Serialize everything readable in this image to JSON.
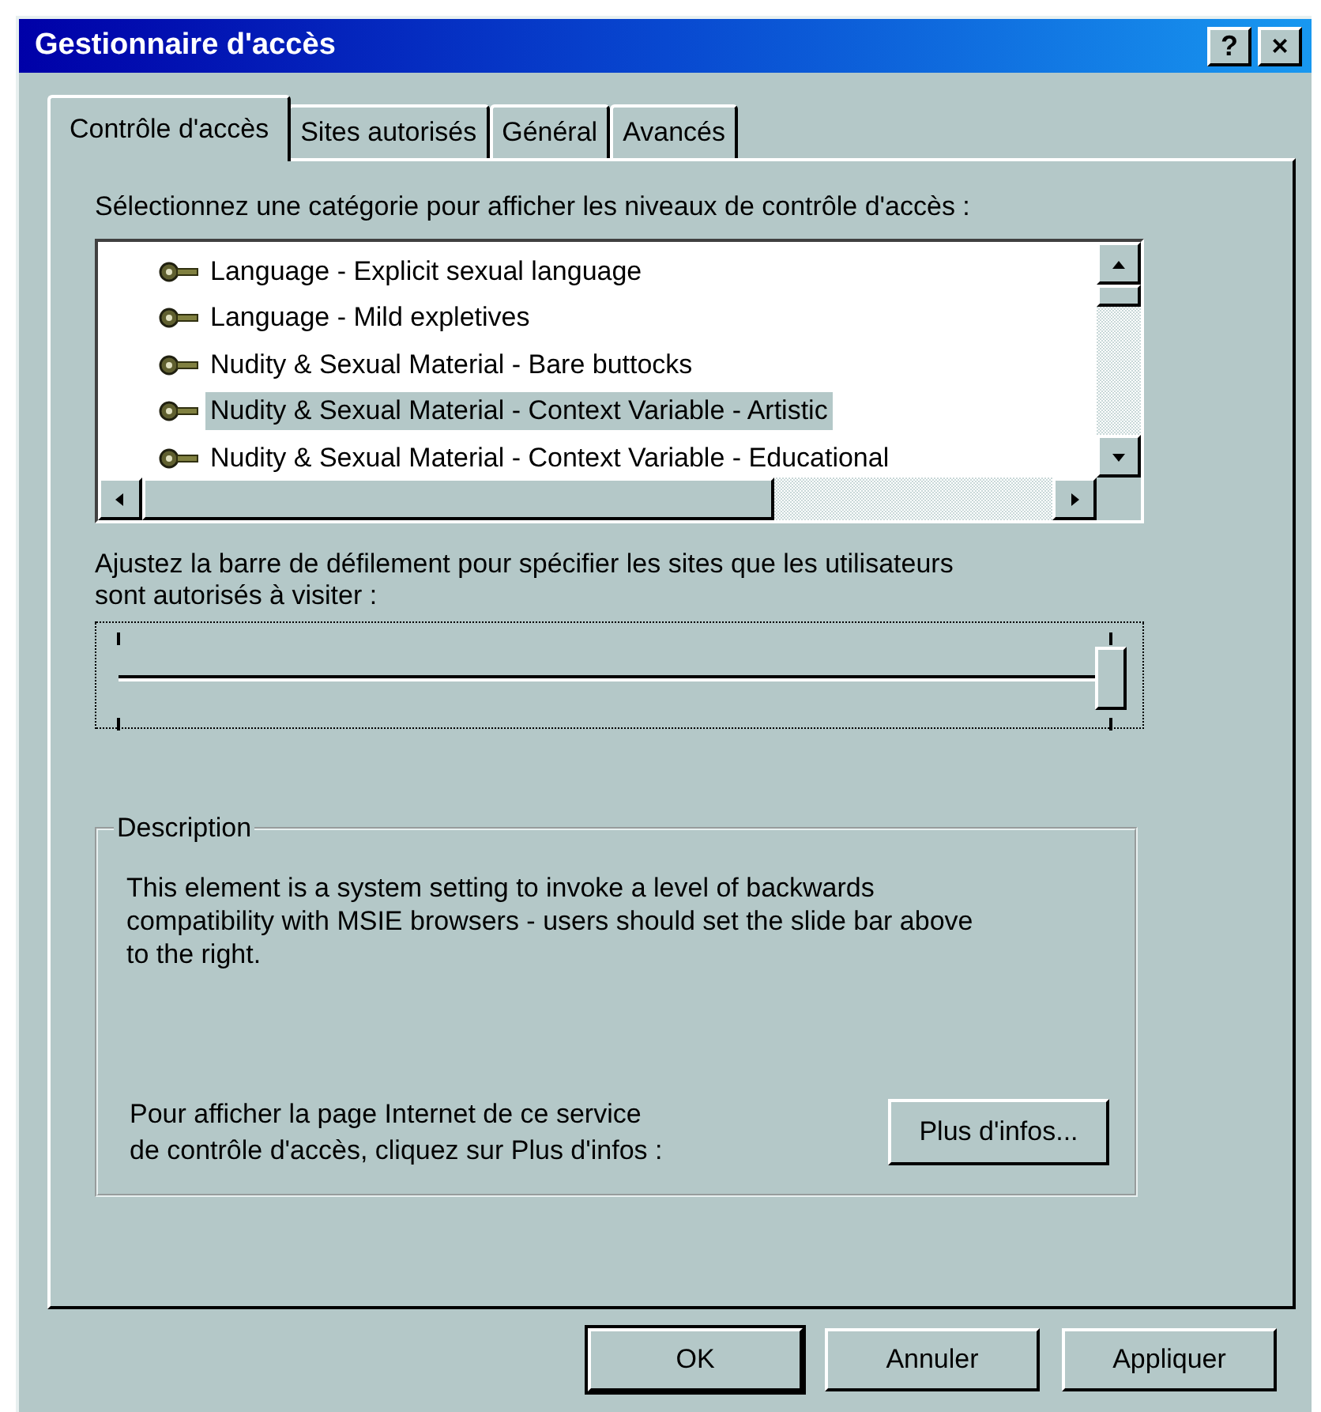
{
  "window": {
    "title": "Gestionnaire d'accès",
    "title_buttons": [
      "?",
      "×"
    ]
  },
  "tabs": [
    {
      "label": "Contrôle d'accès",
      "selected": true
    },
    {
      "label": "Sites autorisés",
      "selected": false
    },
    {
      "label": "Général",
      "selected": false
    },
    {
      "label": "Avancés",
      "selected": false
    }
  ],
  "category_label": "Sélectionnez une catégorie pour afficher les niveaux de contrôle d'accès :",
  "categories": [
    {
      "label": "Language - Explicit sexual language",
      "selected": false
    },
    {
      "label": "Language - Mild expletives",
      "selected": false
    },
    {
      "label": "Nudity & Sexual Material - Bare buttocks",
      "selected": false
    },
    {
      "label": "Nudity & Sexual Material - Context Variable - Artistic",
      "selected": true
    },
    {
      "label": "Nudity & Sexual Material - Context Variable - Educational",
      "selected": false
    }
  ],
  "slider": {
    "label": "Ajustez la barre de défilement pour spécifier les sites que les utilisateurs sont autorisés à visiter :",
    "level": 1
  },
  "description": {
    "legend": "Description",
    "text": "This element is a system setting to invoke a level of backwards compatibility with MSIE browsers - users should set the slide bar above to the right.",
    "info_text": "Pour afficher la page Internet de ce service de contrôle d'accès, cliquez sur Plus d'infos :",
    "info_button": "Plus d'infos..."
  },
  "buttons": [
    {
      "label": "OK",
      "default": true
    },
    {
      "label": "Annuler",
      "default": false
    },
    {
      "label": "Appliquer",
      "default": false
    }
  ]
}
